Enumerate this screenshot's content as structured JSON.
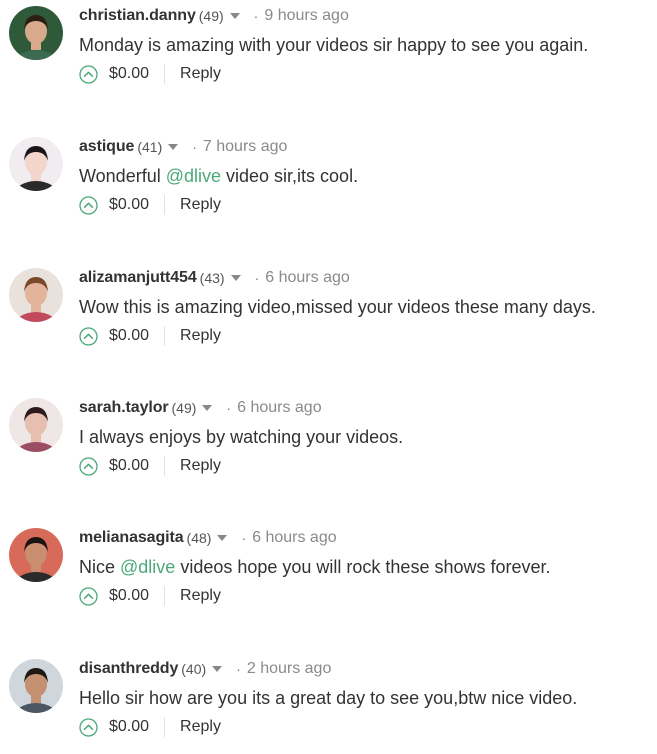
{
  "comments": [
    {
      "author": "christian.danny",
      "reputation": "(49)",
      "time": "9 hours ago",
      "body": [
        {
          "text": "Monday is amazing with your videos sir happy to see you again.",
          "mention": false
        }
      ],
      "payout": "$0.00",
      "reply_label": "Reply",
      "avatar_colors": {
        "bg": "#2f5a3a",
        "skin": "#d9a98b",
        "hair": "#2b1d14",
        "shirt": "#3d6b52"
      }
    },
    {
      "author": "astique",
      "reputation": "(41)",
      "time": "7 hours ago",
      "body": [
        {
          "text": "Wonderful ",
          "mention": false
        },
        {
          "text": "@dlive",
          "mention": true
        },
        {
          "text": " video sir,its cool.",
          "mention": false
        }
      ],
      "payout": "$0.00",
      "reply_label": "Reply",
      "avatar_colors": {
        "bg": "#f0ecef",
        "skin": "#f2d6cc",
        "hair": "#1a1416",
        "shirt": "#2a2a2a"
      }
    },
    {
      "author": "alizamanjutt454",
      "reputation": "(43)",
      "time": "6 hours ago",
      "body": [
        {
          "text": "Wow this is amazing video,missed your videos these many days.",
          "mention": false
        }
      ],
      "payout": "$0.00",
      "reply_label": "Reply",
      "avatar_colors": {
        "bg": "#e9e2dc",
        "skin": "#e3b49a",
        "hair": "#7a4a2b",
        "shirt": "#c24a5b"
      }
    },
    {
      "author": "sarah.taylor",
      "reputation": "(49)",
      "time": "6 hours ago",
      "body": [
        {
          "text": "I always enjoys by watching your videos.",
          "mention": false
        }
      ],
      "payout": "$0.00",
      "reply_label": "Reply",
      "avatar_colors": {
        "bg": "#efe6e6",
        "skin": "#e7bfae",
        "hair": "#2c1a1c",
        "shirt": "#9b4d63"
      }
    },
    {
      "author": "melianasagita",
      "reputation": "(48)",
      "time": "6 hours ago",
      "body": [
        {
          "text": "Nice ",
          "mention": false
        },
        {
          "text": "@dlive",
          "mention": true
        },
        {
          "text": " videos hope you will rock these shows forever.",
          "mention": false
        }
      ],
      "payout": "$0.00",
      "reply_label": "Reply",
      "avatar_colors": {
        "bg": "#d86a5a",
        "skin": "#c98e6f",
        "hair": "#1c1412",
        "shirt": "#2b2b2b"
      }
    },
    {
      "author": "disanthreddy",
      "reputation": "(40)",
      "time": "2 hours ago",
      "body": [
        {
          "text": "Hello sir how are you its a great day to see you,btw nice video.",
          "mention": false
        }
      ],
      "payout": "$0.00",
      "reply_label": "Reply",
      "avatar_colors": {
        "bg": "#cfd6dc",
        "skin": "#c49070",
        "hair": "#1f1712",
        "shirt": "#4a5663"
      }
    }
  ],
  "icons": {
    "vote": "upvote-chevron-circle-icon",
    "caret": "caret-down-icon"
  },
  "colors": {
    "accent": "#4ba878",
    "text": "#333333",
    "muted": "#8a8a8a"
  }
}
